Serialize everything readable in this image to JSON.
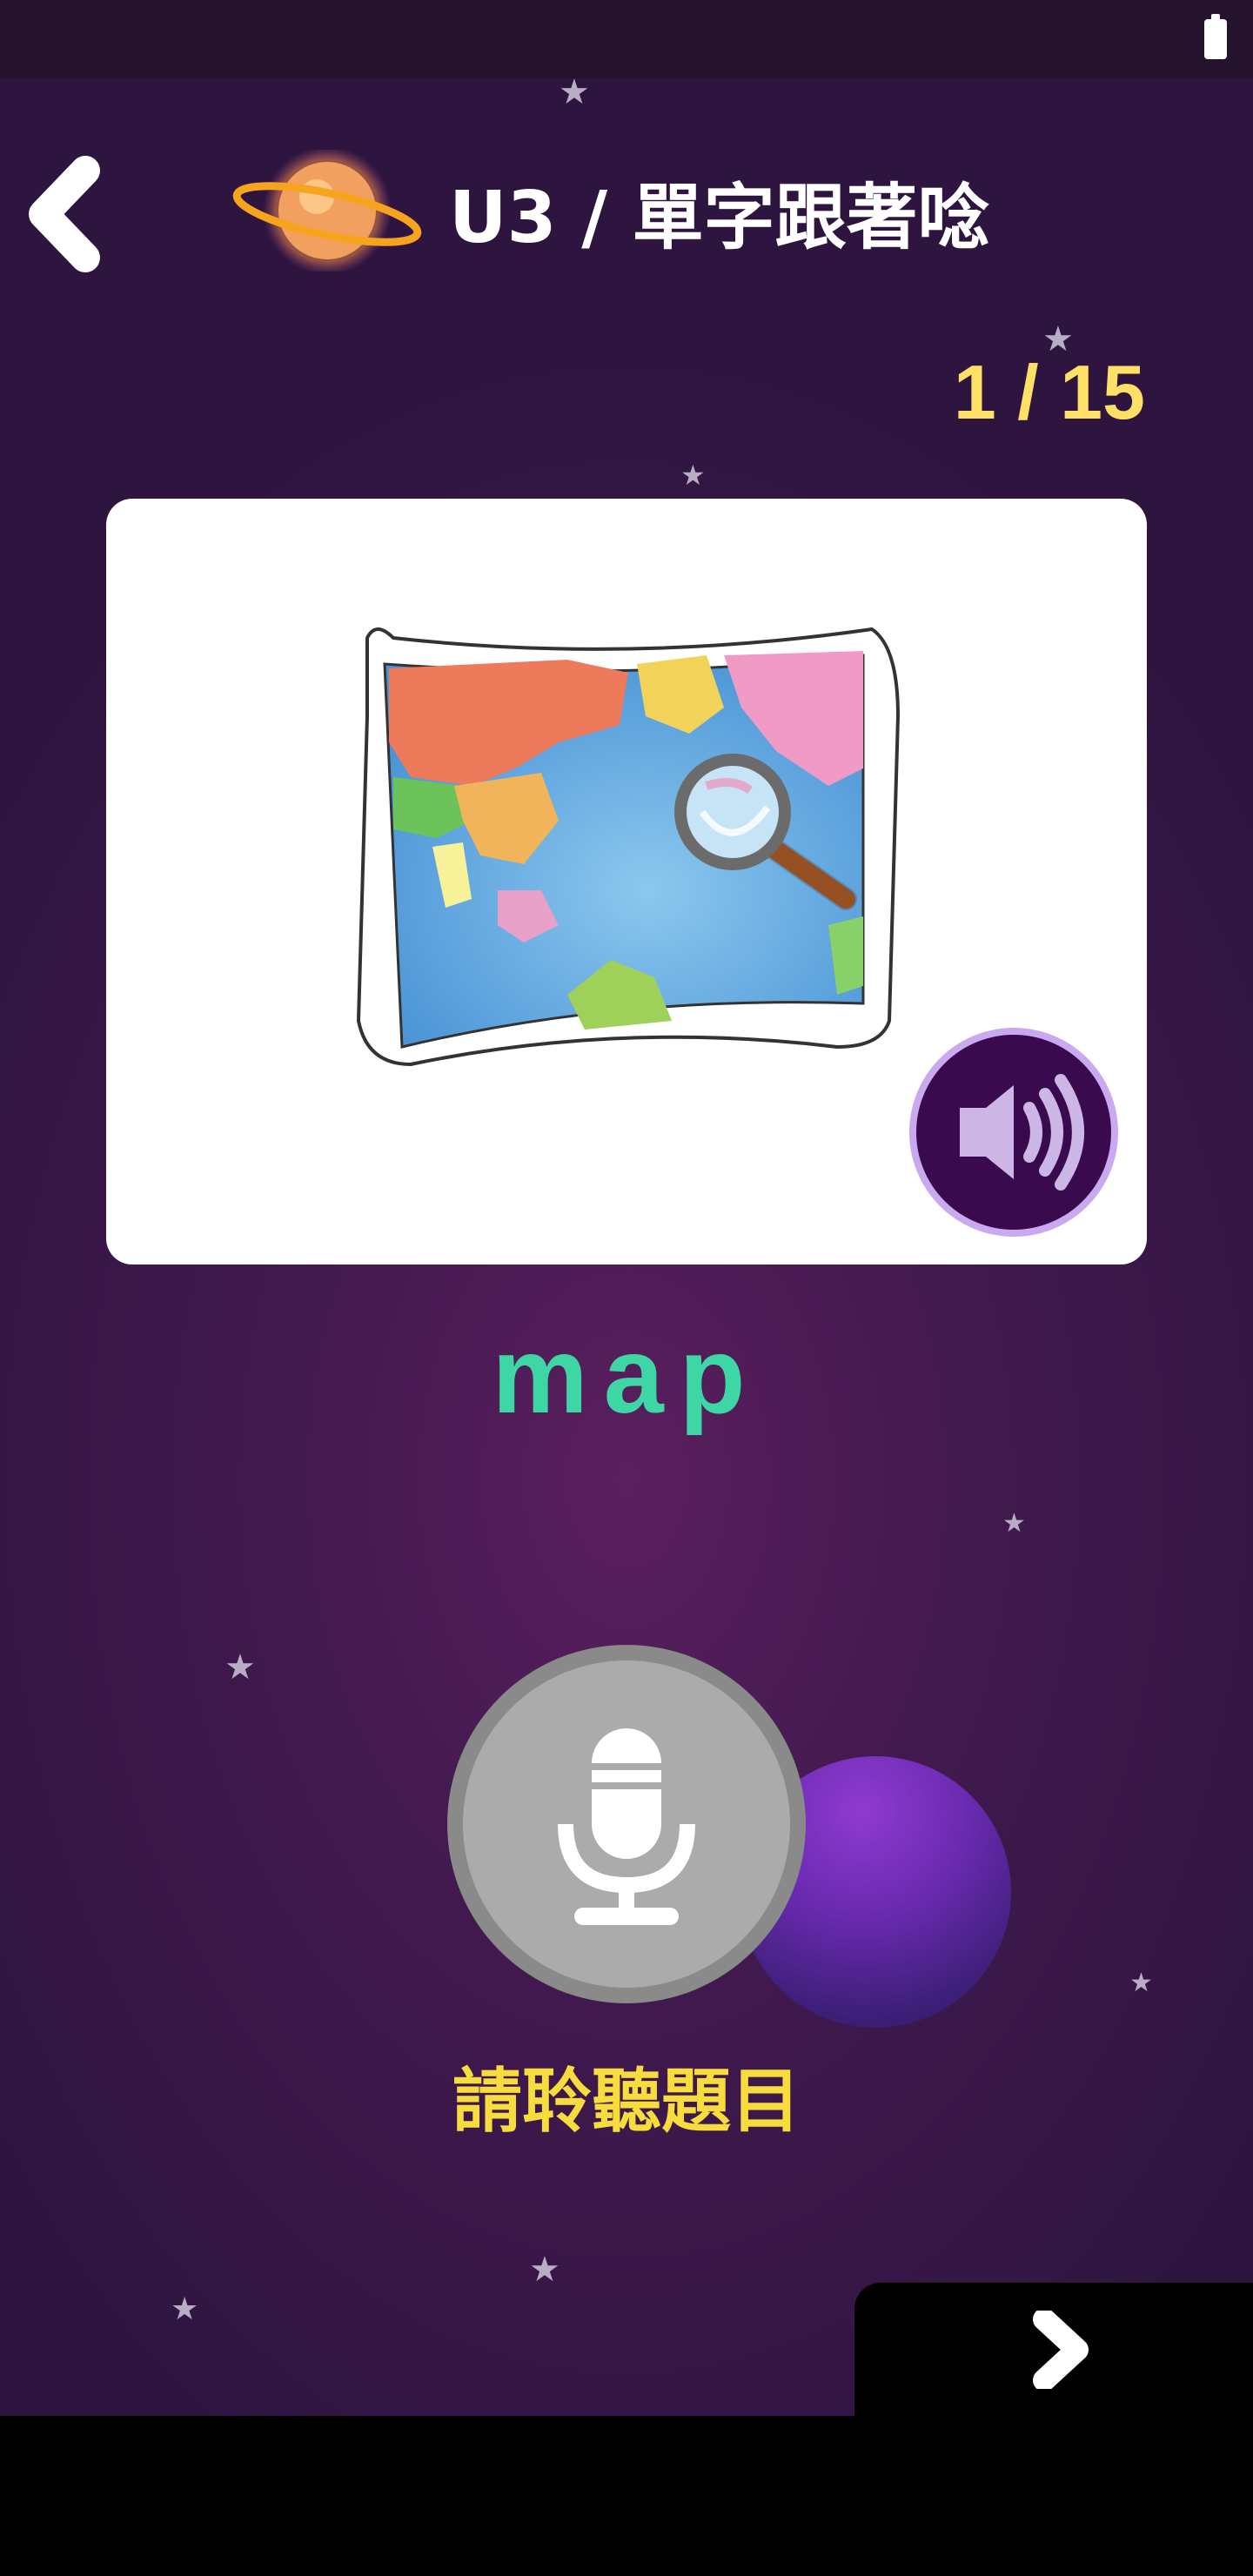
{
  "header": {
    "title": "U3 / 單字跟著唸",
    "back_icon": "chevron-left-icon",
    "logo_icon": "planet-icon"
  },
  "progress": {
    "label": "1 / 15",
    "current": 1,
    "total": 15
  },
  "card": {
    "image_icon": "world-map-magnifier-illustration",
    "speaker_icon": "speaker-volume-icon"
  },
  "word": "map",
  "mic": {
    "icon": "microphone-icon",
    "state": "disabled",
    "prompt": "請聆聽題目"
  },
  "navigation": {
    "next_icon": "chevron-right-icon"
  },
  "colors": {
    "background": "#41194e",
    "title": "#ffffff",
    "counter": "#ffe066",
    "word": "#3fd6a6",
    "prompt": "#f7dc3e",
    "speaker_button": "#3a0a4e",
    "speaker_ring": "#c9a9f0",
    "mic_disabled": "#ababab"
  }
}
